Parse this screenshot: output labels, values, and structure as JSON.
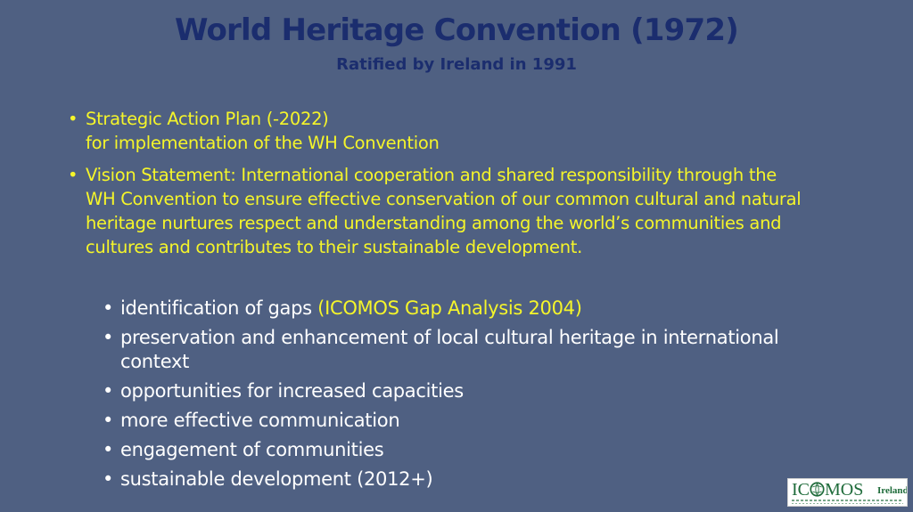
{
  "header": {
    "title": "World Heritage Convention (1972)",
    "subtitle": "Ratified by Ireland in 1991"
  },
  "bullets": [
    {
      "lines": [
        "Strategic Action Plan (-2022)",
        "for implementation of the WH Convention"
      ]
    },
    {
      "lines": [
        "Vision  Statement: International cooperation and shared responsibility through the",
        "WH Convention to ensure effective conservation of our common cultural and natural",
        "heritage nurtures respect and understanding  among the world’s communities and",
        "cultures and contributes to their sustainable development."
      ]
    }
  ],
  "sub_bullets": [
    {
      "text": "identification of gaps ",
      "highlight": "(ICOMOS Gap Analysis 2004)"
    },
    {
      "text": "preservation and enhancement of local cultural heritage in international",
      "continuation": "context"
    },
    {
      "text": "opportunities for increased capacities"
    },
    {
      "text": "more effective communication"
    },
    {
      "text": "engagement of communities"
    },
    {
      "text": "sustainable development (2012+)"
    }
  ],
  "logo": {
    "prefix": "IC",
    "suffix": "MOS",
    "country": "Ireland"
  },
  "colors": {
    "background": "#4f6082",
    "title": "#1b2d6e",
    "highlight": "#f5f52a",
    "body": "#ffffff",
    "logo": "#1e6b3a"
  }
}
